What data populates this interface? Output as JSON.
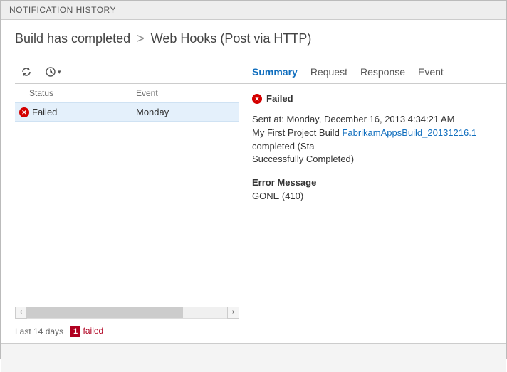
{
  "header": {
    "title": "NOTIFICATION HISTORY"
  },
  "breadcrumb": {
    "event": "Build has completed",
    "separator": ">",
    "consumer": "Web Hooks (Post via HTTP)"
  },
  "left": {
    "columns": {
      "status": "Status",
      "event": "Event"
    },
    "rows": [
      {
        "status": "Failed",
        "event": "Monday"
      }
    ],
    "range": "Last 14 days",
    "badge_count": "1",
    "badge_label": "failed"
  },
  "tabs": {
    "summary": "Summary",
    "request": "Request",
    "response": "Response",
    "event": "Event"
  },
  "detail": {
    "status": "Failed",
    "sent_prefix": "Sent at:",
    "sent_value": "Monday, December 16, 2013 4:34:21 AM",
    "msg_prefix": "My First Project Build",
    "build_link": "FabrikamAppsBuild_20131216.1",
    "msg_suffix1": "completed (Sta",
    "msg_suffix2": "Successfully Completed)",
    "error_title": "Error Message",
    "error_body": "GONE (410)"
  }
}
